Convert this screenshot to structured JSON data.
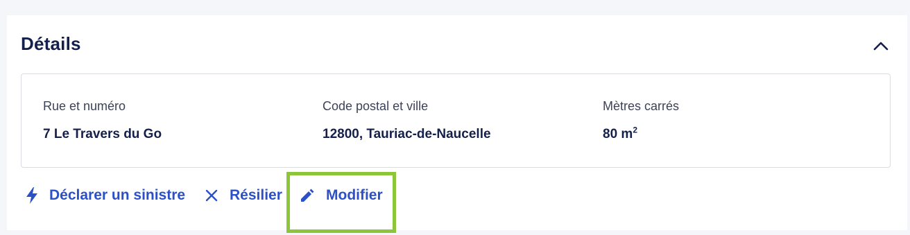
{
  "section": {
    "title": "Détails"
  },
  "details": {
    "fields": [
      {
        "label": "Rue et numéro",
        "value": "7 Le Travers du Go"
      },
      {
        "label": "Code postal et ville",
        "value": "12800, Tauriac-de-Naucelle"
      },
      {
        "label": "Mètres carrés",
        "value": "80 m",
        "value_superscript": "2"
      }
    ]
  },
  "actions": [
    {
      "label": "Déclarer un sinistre",
      "icon": "lightning-icon"
    },
    {
      "label": "Résilier",
      "icon": "close-icon"
    },
    {
      "label": "Modifier",
      "icon": "pencil-icon"
    }
  ],
  "colors": {
    "title": "#14204b",
    "link": "#2b50c8",
    "highlight": "#8cc43a",
    "border": "#d9dce4"
  }
}
